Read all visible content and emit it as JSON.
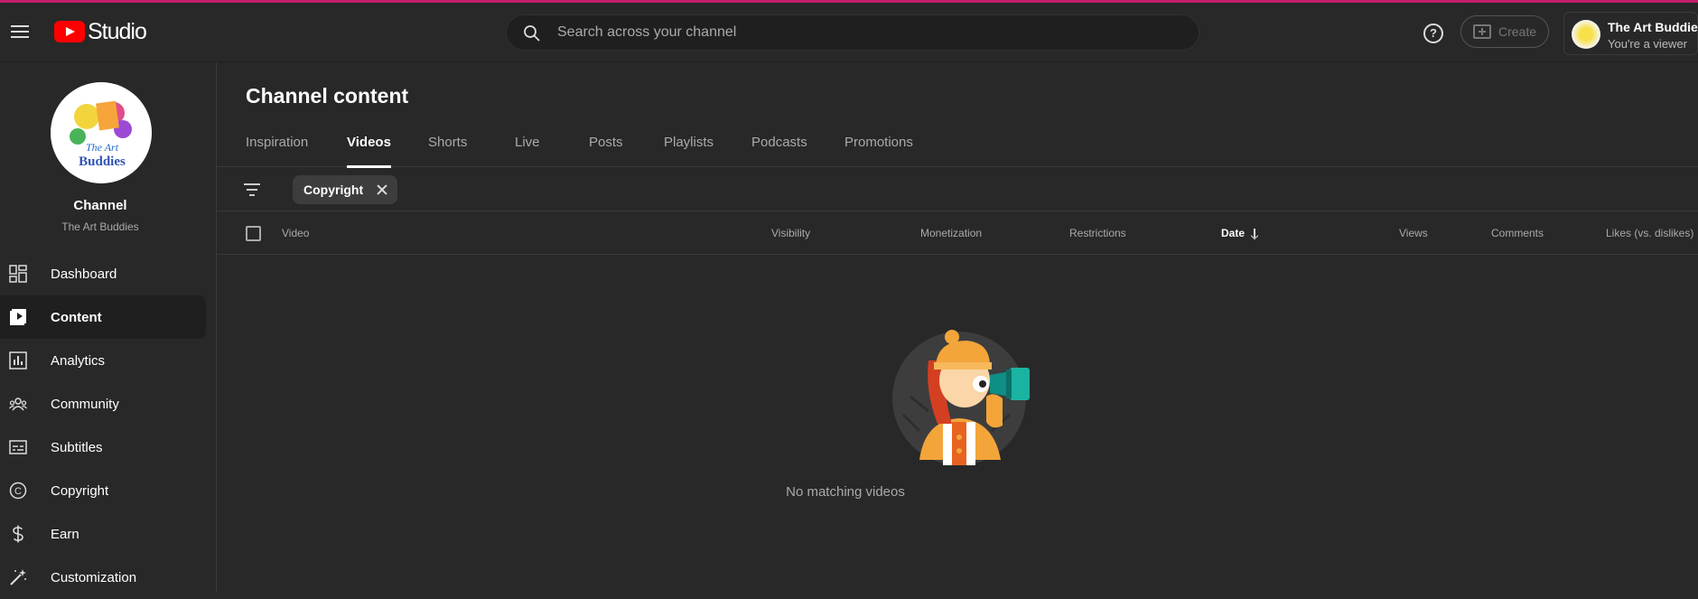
{
  "app": {
    "logo_text": "Studio",
    "search_placeholder": "Search across your channel",
    "create_label": "Create",
    "account_name": "The Art Buddies",
    "account_role": "You're a viewer",
    "help_glyph": "?"
  },
  "sidebar": {
    "channel_label": "Channel",
    "channel_name": "The Art Buddies",
    "avatar_text_1": "The Art",
    "avatar_text_2": "Buddies",
    "items": [
      {
        "label": "Dashboard",
        "icon": "dashboard-icon"
      },
      {
        "label": "Content",
        "icon": "content-icon",
        "active": true
      },
      {
        "label": "Analytics",
        "icon": "analytics-icon"
      },
      {
        "label": "Community",
        "icon": "community-icon"
      },
      {
        "label": "Subtitles",
        "icon": "subtitles-icon"
      },
      {
        "label": "Copyright",
        "icon": "copyright-icon"
      },
      {
        "label": "Earn",
        "icon": "earn-icon"
      },
      {
        "label": "Customization",
        "icon": "customization-icon"
      }
    ]
  },
  "main": {
    "title": "Channel content",
    "tabs": [
      {
        "label": "Inspiration"
      },
      {
        "label": "Videos",
        "active": true
      },
      {
        "label": "Shorts"
      },
      {
        "label": "Live"
      },
      {
        "label": "Posts"
      },
      {
        "label": "Playlists"
      },
      {
        "label": "Podcasts"
      },
      {
        "label": "Promotions"
      }
    ],
    "filter_chip": "Copyright",
    "columns": {
      "video": "Video",
      "visibility": "Visibility",
      "monetization": "Monetization",
      "restrictions": "Restrictions",
      "date": "Date",
      "views": "Views",
      "comments": "Comments",
      "likes": "Likes (vs. dislikes)"
    },
    "empty_message": "No matching videos"
  },
  "colors": {
    "accent_line": "#c41e6b",
    "background": "#282828",
    "youtube_red": "#ff0000"
  }
}
